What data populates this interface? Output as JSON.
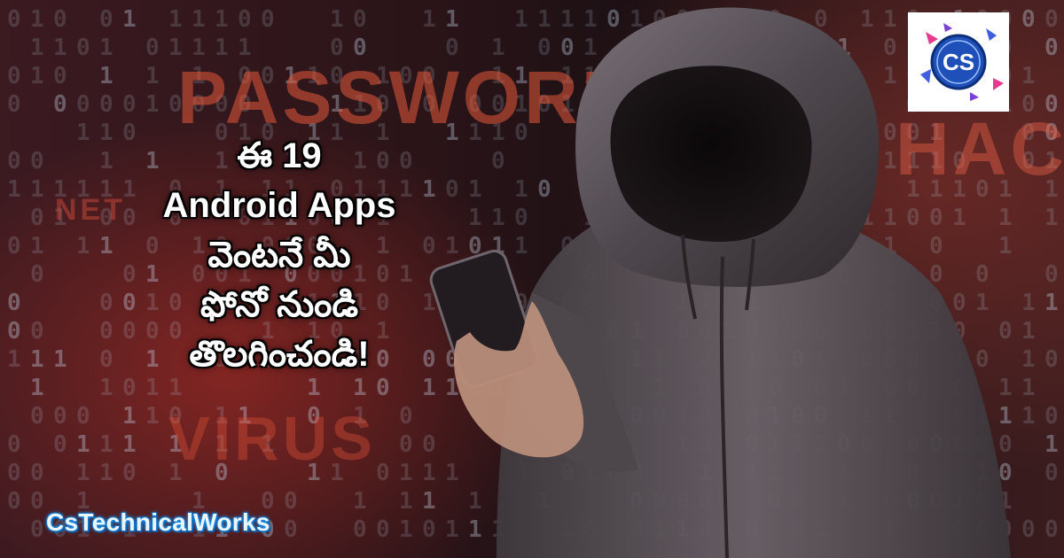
{
  "background": {
    "words": {
      "password": "PASSWORD",
      "hack": "HACK",
      "virus": "VIRUS",
      "net": "NET"
    }
  },
  "headline": {
    "lines": [
      "ఈ 19",
      "Android Apps",
      "వెంటనే మీ",
      "ఫోనో నుండి",
      "తొలగించండి!"
    ]
  },
  "logo": {
    "text": "CS"
  },
  "brand": {
    "name": "CsTechnicalWorks"
  },
  "colors": {
    "accent_red": "#e0553c",
    "brand_blue": "#1b7fd6",
    "logo_blue": "#1f4fb8"
  }
}
